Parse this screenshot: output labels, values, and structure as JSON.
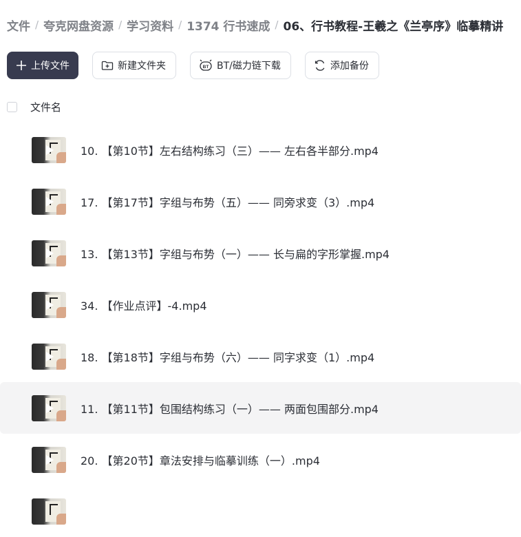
{
  "breadcrumb": [
    {
      "label": "文件"
    },
    {
      "label": "夸克网盘资源"
    },
    {
      "label": "学习资料"
    },
    {
      "label": "1374 行书速成"
    },
    {
      "label": "06、行书教程-王羲之《兰亭序》临摹精讲"
    }
  ],
  "toolbar": {
    "upload_label": "上传文件",
    "new_folder_label": "新建文件夹",
    "bt_label": "BT/磁力链下载",
    "backup_label": "添加备份"
  },
  "list_header": {
    "name_label": "文件名"
  },
  "files": [
    {
      "name": "10. 【第10节】左右结构练习（三）—— 左右各半部分.mp4"
    },
    {
      "name": "17. 【第17节】字组与布势（五）—— 同旁求变（3）.mp4"
    },
    {
      "name": "13. 【第13节】字组与布势（一）—— 长与扁的字形掌握.mp4"
    },
    {
      "name": "34. 【作业点评】-4.mp4"
    },
    {
      "name": "18. 【第18节】字组与布势（六）—— 同字求变（1）.mp4"
    },
    {
      "name": "11. 【第11节】包围结构练习（一）—— 两面包围部分.mp4"
    },
    {
      "name": "20. 【第20节】章法安排与临摹训练（一）.mp4"
    }
  ],
  "colors": {
    "primary_button": "#383b4f",
    "hover_row": "#f4f4f5"
  }
}
